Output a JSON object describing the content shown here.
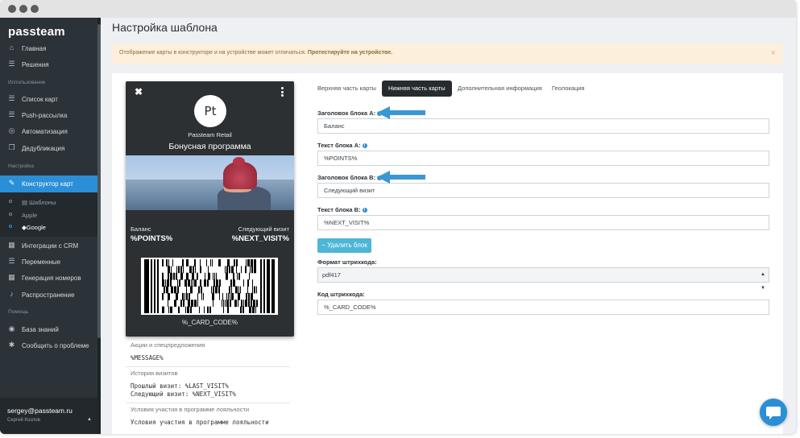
{
  "app": {
    "logo": "passteam"
  },
  "sidebar": {
    "items_top": [
      {
        "label": "Главная",
        "icon": "home-icon"
      },
      {
        "label": "Решения",
        "icon": "list-icon"
      }
    ],
    "section_usage": "Использование",
    "items_usage": [
      {
        "label": "Список карт",
        "icon": "list-icon"
      },
      {
        "label": "Push-рассылка",
        "icon": "push-icon"
      },
      {
        "label": "Автоматизация",
        "icon": "automation-icon"
      },
      {
        "label": "Дедубликация",
        "icon": "copy-icon"
      }
    ],
    "section_settings": "Настройка",
    "active_item": {
      "label": "Конструктор карт",
      "icon": "brush-icon"
    },
    "subitems": [
      {
        "label": "Шаблоны",
        "icon": "templates-icon"
      },
      {
        "label": "Apple",
        "icon": "apple-icon"
      },
      {
        "label": "Google",
        "icon": "google-icon"
      }
    ],
    "items_settings": [
      {
        "label": "Интеграции с CRM",
        "icon": "grid-icon"
      },
      {
        "label": "Переменные",
        "icon": "list-icon"
      },
      {
        "label": "Генерация номеров",
        "icon": "grid-icon"
      },
      {
        "label": "Распространение",
        "icon": "bell-icon"
      }
    ],
    "section_help": "Помощь",
    "items_help": [
      {
        "label": "База знаний",
        "icon": "globe-icon"
      },
      {
        "label": "Сообщить о проблеме",
        "icon": "bug-icon"
      }
    ],
    "user": {
      "email": "sergey@passteam.ru",
      "name": "Сергей Козлов"
    }
  },
  "page": {
    "title": "Настройка шаблона",
    "alert_text": "Отображение карты в конструкторе и на устройстве может отличаться.",
    "alert_link": "Протестируйте на устройстве."
  },
  "card": {
    "logo_text": "Pt",
    "org": "Passteam Retail",
    "program": "Бонусная программа",
    "field_a_label": "Баланс",
    "field_a_value": "%POINTS%",
    "field_b_label": "Следующий визит",
    "field_b_value": "%NEXT_VISIT%",
    "code": "%_CARD_CODE%"
  },
  "back": [
    {
      "label": "Акции и спецпредложения",
      "value": "%MESSAGE%"
    },
    {
      "label": "История визитов",
      "value_lines": [
        "Прошлый визит: %LAST_VISIT%",
        "Следующий визит:  %NEXT_VISIT%"
      ]
    },
    {
      "label": "Условия участия в программе лояльности",
      "value": "Условия участия в программе лояльности"
    }
  ],
  "tabs": [
    {
      "label": "Верхняя часть карты",
      "active": false
    },
    {
      "label": "Нижняя часть карты",
      "active": true
    },
    {
      "label": "Дополнительная информация",
      "active": false
    },
    {
      "label": "Геолокация",
      "active": false
    }
  ],
  "form": {
    "block_a_title_label": "Заголовок блока A:",
    "block_a_title_value": "Баланс",
    "block_a_text_label": "Текст блока A:",
    "block_a_text_value": "%POINTS%",
    "block_b_title_label": "Заголовок блока B:",
    "block_b_title_value": "Следующий визит",
    "block_b_text_label": "Текст блока B:",
    "block_b_text_value": "%NEXT_VISIT%",
    "delete_button": "Удалить блок",
    "barcode_format_label": "Формат штрихкода:",
    "barcode_format_value": "pdf417",
    "barcode_code_label": "Код штрихкода:",
    "barcode_code_value": "%_CARD_CODE%"
  },
  "colors": {
    "accent": "#2a8fd6",
    "sidebar": "#2c3338",
    "alert_bg": "#fcefdb",
    "delete_button": "#4db6d6",
    "arrow": "#3a97d4"
  }
}
